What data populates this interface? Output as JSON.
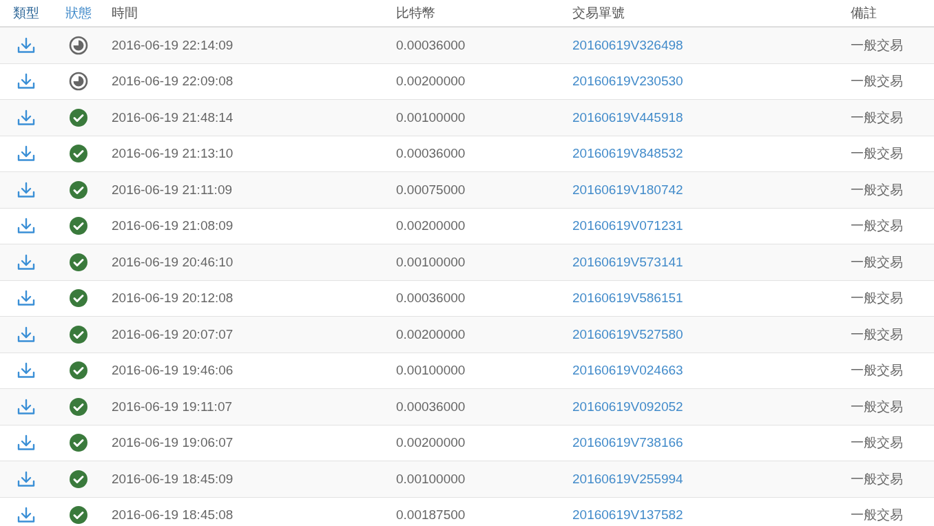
{
  "table": {
    "columns": [
      {
        "label": "類型",
        "kind": "link",
        "selected": true
      },
      {
        "label": "狀態",
        "kind": "link",
        "selected": false
      },
      {
        "label": "時間",
        "kind": "text",
        "selected": false
      },
      {
        "label": "比特幣",
        "kind": "text",
        "selected": false
      },
      {
        "label": "交易單號",
        "kind": "text",
        "selected": false
      },
      {
        "label": "備註",
        "kind": "text",
        "selected": false
      }
    ],
    "rows": [
      {
        "completed": false,
        "time": "2016-06-19 22:14:09",
        "btc": "0.00036000",
        "txid": "20160619V326498",
        "note": "一般交易"
      },
      {
        "completed": false,
        "time": "2016-06-19 22:09:08",
        "btc": "0.00200000",
        "txid": "20160619V230530",
        "note": "一般交易"
      },
      {
        "completed": true,
        "time": "2016-06-19 21:48:14",
        "btc": "0.00100000",
        "txid": "20160619V445918",
        "note": "一般交易"
      },
      {
        "completed": true,
        "time": "2016-06-19 21:13:10",
        "btc": "0.00036000",
        "txid": "20160619V848532",
        "note": "一般交易"
      },
      {
        "completed": true,
        "time": "2016-06-19 21:11:09",
        "btc": "0.00075000",
        "txid": "20160619V180742",
        "note": "一般交易"
      },
      {
        "completed": true,
        "time": "2016-06-19 21:08:09",
        "btc": "0.00200000",
        "txid": "20160619V071231",
        "note": "一般交易"
      },
      {
        "completed": true,
        "time": "2016-06-19 20:46:10",
        "btc": "0.00100000",
        "txid": "20160619V573141",
        "note": "一般交易"
      },
      {
        "completed": true,
        "time": "2016-06-19 20:12:08",
        "btc": "0.00036000",
        "txid": "20160619V586151",
        "note": "一般交易"
      },
      {
        "completed": true,
        "time": "2016-06-19 20:07:07",
        "btc": "0.00200000",
        "txid": "20160619V527580",
        "note": "一般交易"
      },
      {
        "completed": true,
        "time": "2016-06-19 19:46:06",
        "btc": "0.00100000",
        "txid": "20160619V024663",
        "note": "一般交易"
      },
      {
        "completed": true,
        "time": "2016-06-19 19:11:07",
        "btc": "0.00036000",
        "txid": "20160619V092052",
        "note": "一般交易"
      },
      {
        "completed": true,
        "time": "2016-06-19 19:06:07",
        "btc": "0.00200000",
        "txid": "20160619V738166",
        "note": "一般交易"
      },
      {
        "completed": true,
        "time": "2016-06-19 18:45:09",
        "btc": "0.00100000",
        "txid": "20160619V255994",
        "note": "一般交易"
      },
      {
        "completed": true,
        "time": "2016-06-19 18:45:08",
        "btc": "0.00187500",
        "txid": "20160619V137582",
        "note": "一般交易"
      }
    ]
  }
}
